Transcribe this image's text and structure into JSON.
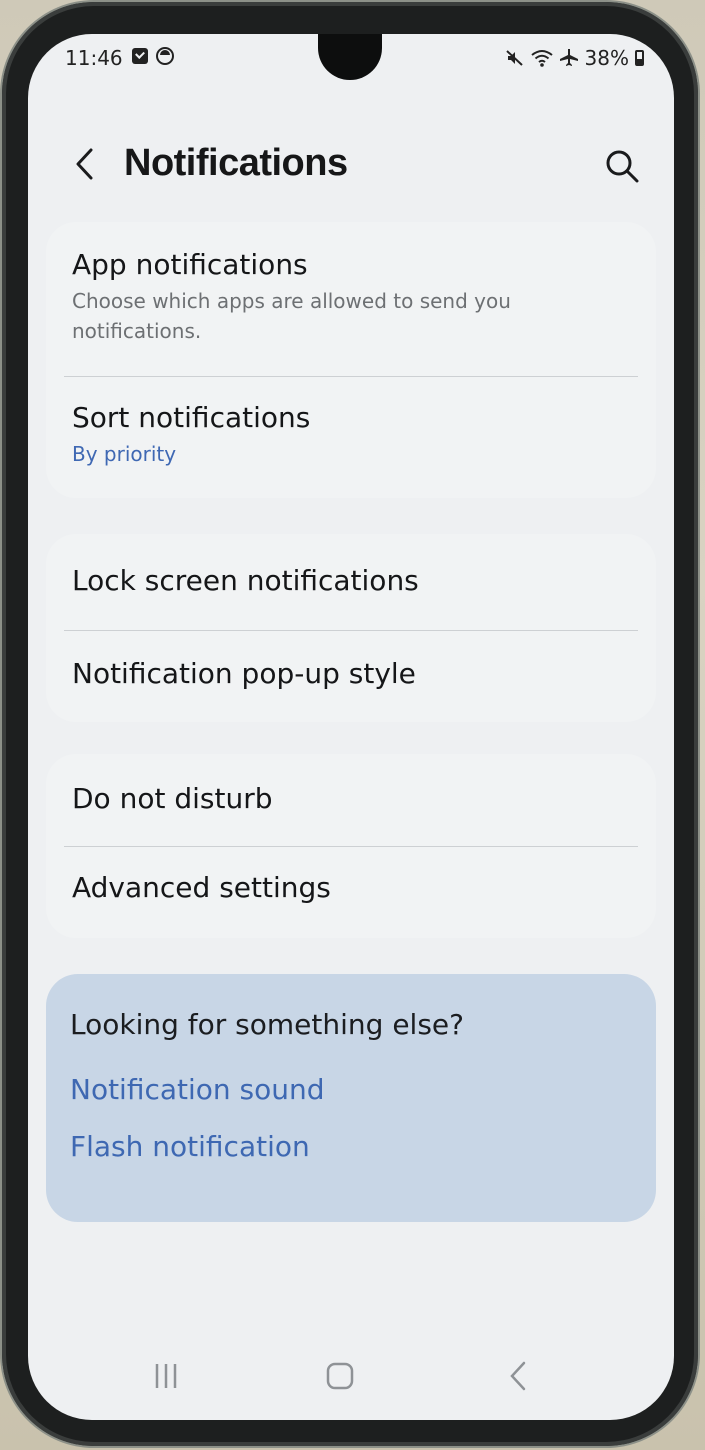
{
  "status_bar": {
    "time": "11:46",
    "battery": "38%",
    "icons_left": [
      "message-icon",
      "sync-icon"
    ],
    "icons_right": [
      "mute-icon",
      "wifi-icon",
      "airplane-icon",
      "battery-icon"
    ]
  },
  "header": {
    "title": "Notifications",
    "back_icon": "back-chevron-icon",
    "search_icon": "search-icon"
  },
  "groups": [
    {
      "items": [
        {
          "title": "App notifications",
          "subtitle": "Choose which apps are allowed to send you notifications."
        },
        {
          "title": "Sort notifications",
          "subtitle": "By priority"
        }
      ]
    },
    {
      "items": [
        {
          "title": "Lock screen notifications"
        },
        {
          "title": "Notification pop-up style"
        }
      ]
    },
    {
      "items": [
        {
          "title": "Do not disturb"
        },
        {
          "title": "Advanced settings"
        }
      ]
    }
  ],
  "suggestions": {
    "title": "Looking for something else?",
    "links": [
      "Notification sound",
      "Flash notification"
    ]
  },
  "colors": {
    "screen_bg": "#eef0f2",
    "card_bg": "#f1f3f4",
    "accent_link": "#3e68b2",
    "suggest_bg": "#c8d6e6"
  },
  "nav_bar": {
    "recent_icon": "recent-apps-icon",
    "home_icon": "home-icon",
    "back_icon": "nav-back-icon"
  }
}
